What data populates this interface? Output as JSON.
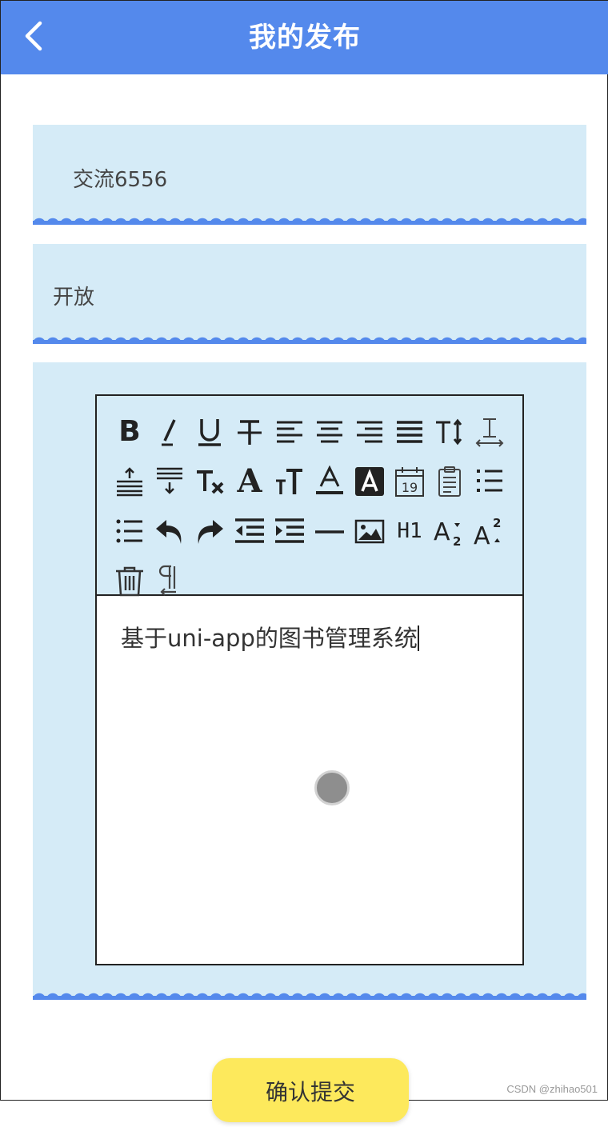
{
  "header": {
    "title": "我的发布"
  },
  "form": {
    "title_value": "交流6556",
    "status_value": "开放",
    "editor_content": "基于uni-app的图书管理系统"
  },
  "toolbar": {
    "tools": [
      "bold-icon",
      "italic-icon",
      "underline-icon",
      "strikethrough-icon",
      "align-left-icon",
      "align-center-icon",
      "align-right-icon",
      "align-justify-icon",
      "letter-spacing-icon",
      "line-height-icon",
      "space-before-icon",
      "space-after-icon",
      "clear-format-icon",
      "font-icon",
      "font-size-icon",
      "font-color-icon",
      "background-color-icon",
      "date-icon",
      "checklist-icon",
      "ordered-list-icon",
      "bullet-list-icon",
      "undo-icon",
      "redo-icon",
      "outdent-icon",
      "indent-icon",
      "divider-icon",
      "image-icon",
      "heading-icon",
      "subscript-icon",
      "superscript-icon",
      "delete-icon",
      "text-direction-icon"
    ]
  },
  "submit": {
    "label": "确认提交"
  },
  "watermark": "CSDN @zhihao501",
  "colors": {
    "primary": "#5489ec",
    "field_bg": "#d5ebf7",
    "submit_bg": "#fde95c"
  }
}
